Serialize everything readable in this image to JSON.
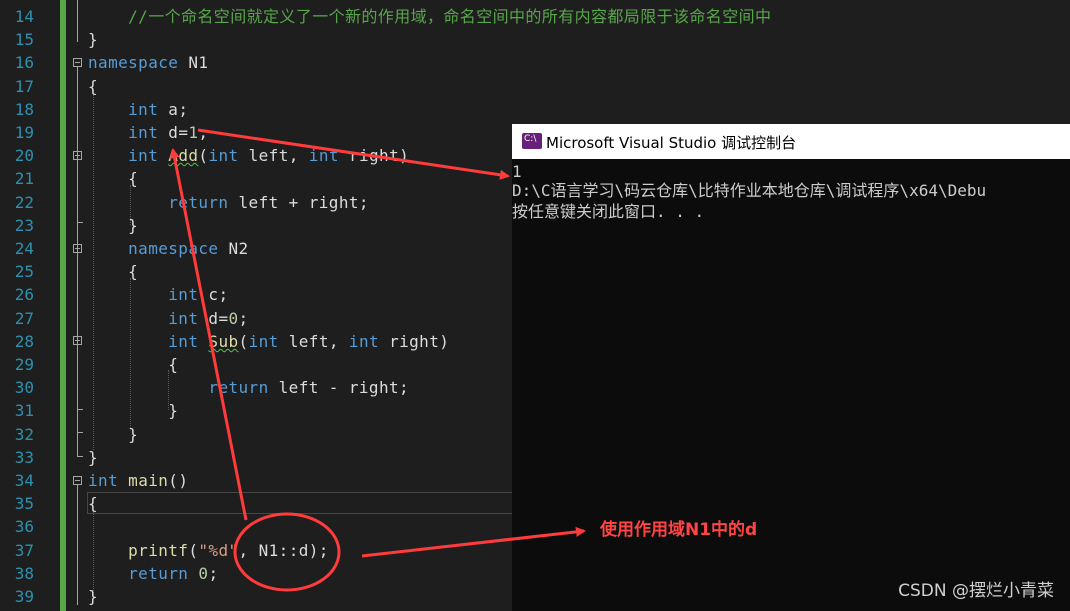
{
  "editor": {
    "lines": [
      {
        "num": "14",
        "segments": [
          {
            "t": "    //一个命名空间就定义了一个新的作用域，命名空间中的所有内容都局限于该命名空间中",
            "c": "cm"
          }
        ]
      },
      {
        "num": "15",
        "segments": [
          {
            "t": "}",
            "c": ""
          }
        ]
      },
      {
        "num": "16",
        "segments": [
          {
            "t": "namespace",
            "c": "kw"
          },
          {
            "t": " N1",
            "c": ""
          }
        ]
      },
      {
        "num": "17",
        "segments": [
          {
            "t": "{",
            "c": ""
          }
        ]
      },
      {
        "num": "18",
        "segments": [
          {
            "t": "    ",
            "c": ""
          },
          {
            "t": "int",
            "c": "kw"
          },
          {
            "t": " a;",
            "c": ""
          }
        ]
      },
      {
        "num": "19",
        "segments": [
          {
            "t": "    ",
            "c": ""
          },
          {
            "t": "int",
            "c": "kw"
          },
          {
            "t": " d=",
            "c": ""
          },
          {
            "t": "1",
            "c": "num"
          },
          {
            "t": ";",
            "c": ""
          }
        ]
      },
      {
        "num": "20",
        "segments": [
          {
            "t": "    ",
            "c": ""
          },
          {
            "t": "int",
            "c": "kw"
          },
          {
            "t": " ",
            "c": ""
          },
          {
            "t": "Add",
            "c": "fn squig"
          },
          {
            "t": "(",
            "c": ""
          },
          {
            "t": "int",
            "c": "kw"
          },
          {
            "t": " left, ",
            "c": ""
          },
          {
            "t": "int",
            "c": "kw"
          },
          {
            "t": " right)",
            "c": ""
          }
        ]
      },
      {
        "num": "21",
        "segments": [
          {
            "t": "    {",
            "c": ""
          }
        ]
      },
      {
        "num": "22",
        "segments": [
          {
            "t": "        ",
            "c": ""
          },
          {
            "t": "return",
            "c": "kw"
          },
          {
            "t": " left + right;",
            "c": ""
          }
        ]
      },
      {
        "num": "23",
        "segments": [
          {
            "t": "    }",
            "c": ""
          }
        ]
      },
      {
        "num": "24",
        "segments": [
          {
            "t": "    ",
            "c": ""
          },
          {
            "t": "namespace",
            "c": "kw"
          },
          {
            "t": " N2",
            "c": ""
          }
        ]
      },
      {
        "num": "25",
        "segments": [
          {
            "t": "    {",
            "c": ""
          }
        ]
      },
      {
        "num": "26",
        "segments": [
          {
            "t": "        ",
            "c": ""
          },
          {
            "t": "int",
            "c": "kw"
          },
          {
            "t": " c;",
            "c": ""
          }
        ]
      },
      {
        "num": "27",
        "segments": [
          {
            "t": "        ",
            "c": ""
          },
          {
            "t": "int",
            "c": "kw"
          },
          {
            "t": " d=",
            "c": ""
          },
          {
            "t": "0",
            "c": "num"
          },
          {
            "t": ";",
            "c": ""
          }
        ]
      },
      {
        "num": "28",
        "segments": [
          {
            "t": "        ",
            "c": ""
          },
          {
            "t": "int",
            "c": "kw"
          },
          {
            "t": " ",
            "c": ""
          },
          {
            "t": "Sub",
            "c": "fn squig"
          },
          {
            "t": "(",
            "c": ""
          },
          {
            "t": "int",
            "c": "kw"
          },
          {
            "t": " left, ",
            "c": ""
          },
          {
            "t": "int",
            "c": "kw"
          },
          {
            "t": " right)",
            "c": ""
          }
        ]
      },
      {
        "num": "29",
        "segments": [
          {
            "t": "        {",
            "c": ""
          }
        ]
      },
      {
        "num": "30",
        "segments": [
          {
            "t": "            ",
            "c": ""
          },
          {
            "t": "return",
            "c": "kw"
          },
          {
            "t": " left - right;",
            "c": ""
          }
        ]
      },
      {
        "num": "31",
        "segments": [
          {
            "t": "        }",
            "c": ""
          }
        ]
      },
      {
        "num": "32",
        "segments": [
          {
            "t": "    }",
            "c": ""
          }
        ]
      },
      {
        "num": "33",
        "segments": [
          {
            "t": "}",
            "c": ""
          }
        ]
      },
      {
        "num": "34",
        "segments": [
          {
            "t": "int",
            "c": "kw"
          },
          {
            "t": " ",
            "c": ""
          },
          {
            "t": "main",
            "c": "fn"
          },
          {
            "t": "()",
            "c": ""
          }
        ]
      },
      {
        "num": "35",
        "segments": [
          {
            "t": "{",
            "c": ""
          }
        ]
      },
      {
        "num": "36",
        "segments": [
          {
            "t": "",
            "c": ""
          }
        ]
      },
      {
        "num": "37",
        "segments": [
          {
            "t": "    ",
            "c": ""
          },
          {
            "t": "printf",
            "c": "fn"
          },
          {
            "t": "(",
            "c": ""
          },
          {
            "t": "\"%d\"",
            "c": "str"
          },
          {
            "t": ", N1::d);",
            "c": ""
          }
        ]
      },
      {
        "num": "38",
        "segments": [
          {
            "t": "    ",
            "c": ""
          },
          {
            "t": "return",
            "c": "kw"
          },
          {
            "t": " ",
            "c": ""
          },
          {
            "t": "0",
            "c": "num"
          },
          {
            "t": ";",
            "c": ""
          }
        ]
      },
      {
        "num": "39",
        "segments": [
          {
            "t": "}",
            "c": ""
          }
        ]
      }
    ]
  },
  "console": {
    "title": "Microsoft Visual Studio 调试控制台",
    "icon_label": "C:\\",
    "output": [
      "1",
      "D:\\C语言学习\\码云仓库\\比特作业本地仓库\\调试程序\\x64\\Debu",
      "按任意键关闭此窗口. . ."
    ]
  },
  "annotation": {
    "note": "使用作用域N1中的d",
    "color": "#ff3b3b"
  },
  "watermark": "CSDN @摆烂小青菜"
}
